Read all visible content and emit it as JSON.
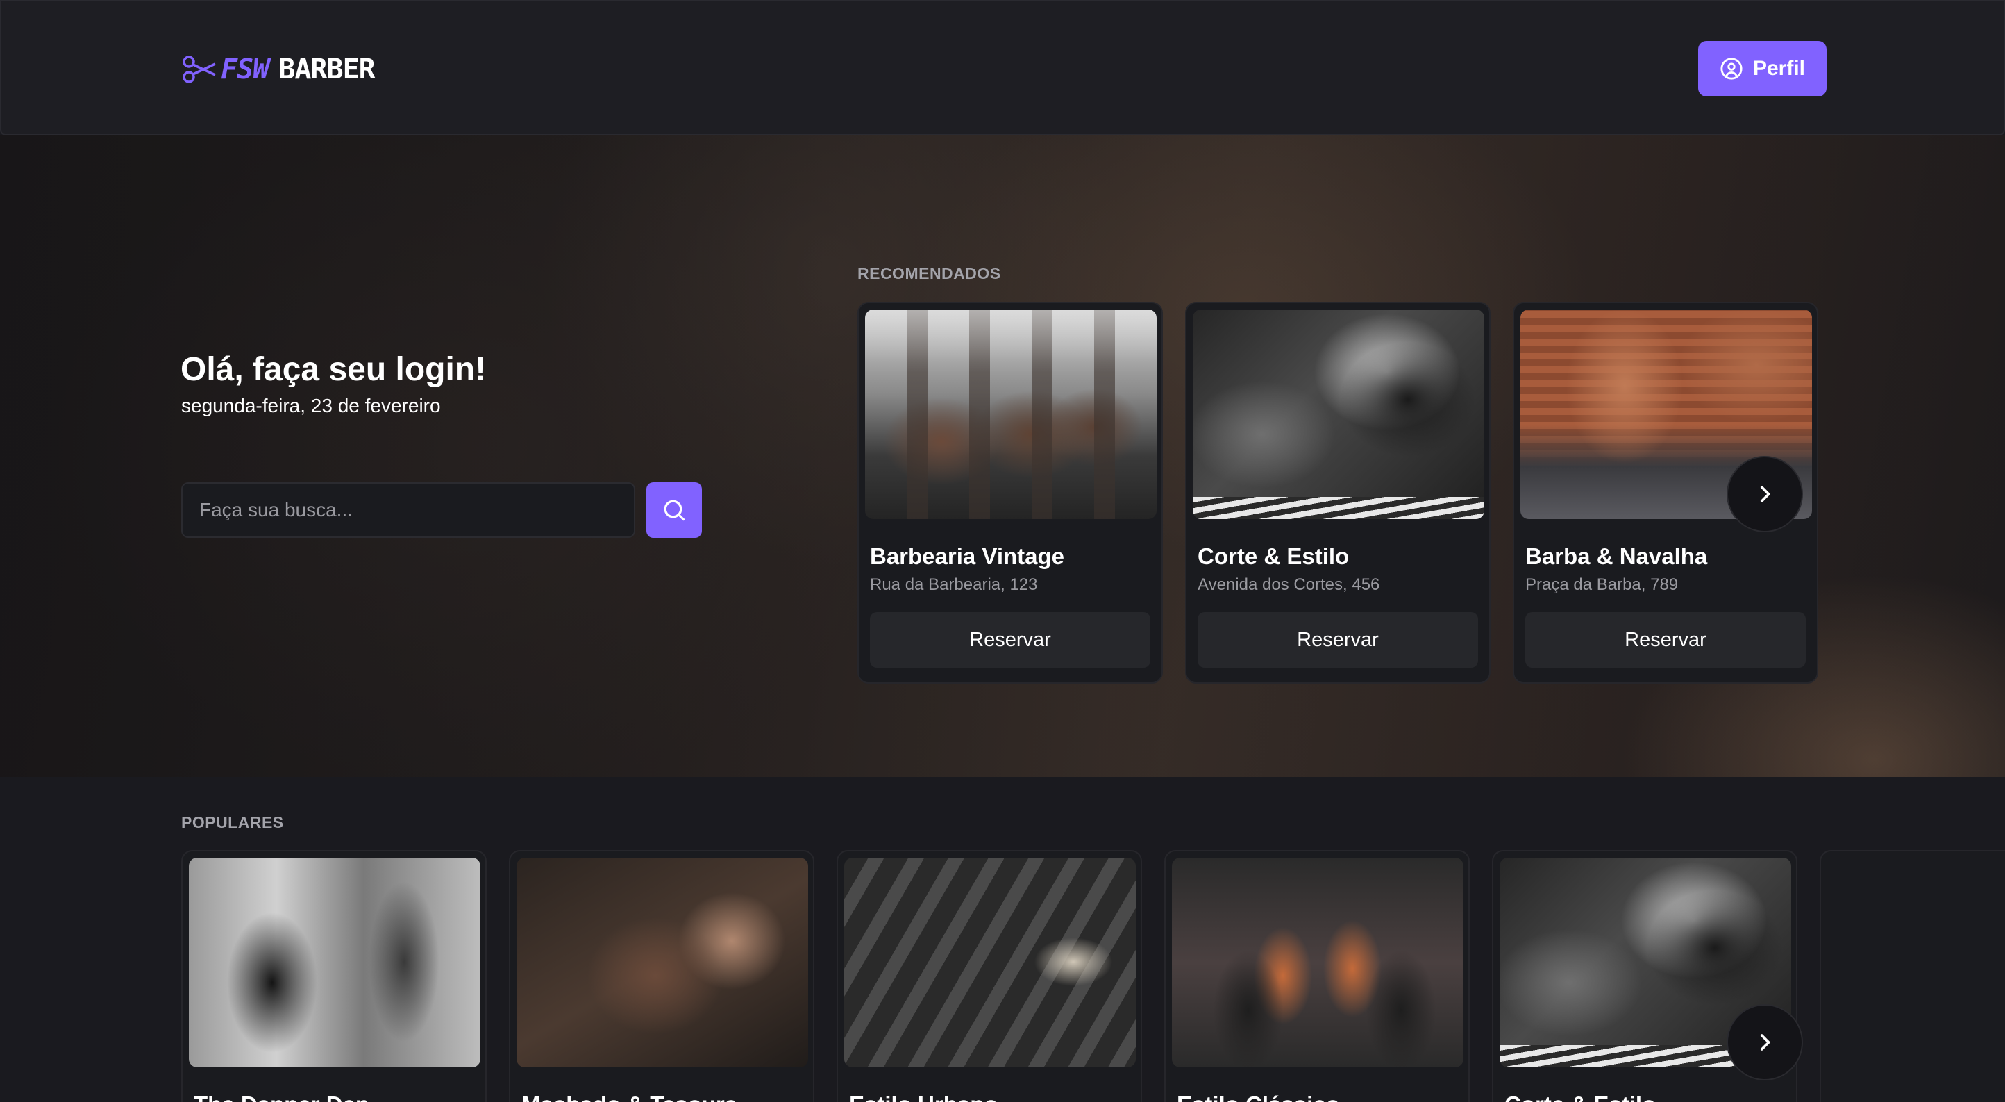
{
  "header": {
    "logo_fsw": "FSW",
    "logo_barber": "BARBER",
    "profile_label": "Perfil"
  },
  "hero": {
    "greeting": "Olá, faça seu login!",
    "date": "segunda-feira, 23 de fevereiro",
    "search_placeholder": "Faça sua busca..."
  },
  "recommended": {
    "title": "RECOMENDADOS",
    "items": [
      {
        "name": "Barbearia Vintage",
        "address": "Rua da Barbearia, 123",
        "button": "Reservar"
      },
      {
        "name": "Corte & Estilo",
        "address": "Avenida dos Cortes, 456",
        "button": "Reservar"
      },
      {
        "name": "Barba & Navalha",
        "address": "Praça da Barba, 789",
        "button": "Reservar"
      }
    ]
  },
  "popular": {
    "title": "POPULARES",
    "items": [
      {
        "name": "The Dapper Den"
      },
      {
        "name": "Machado & Tesoura"
      },
      {
        "name": "Estilo Urbano"
      },
      {
        "name": "Estilo Clássico"
      },
      {
        "name": "Corte & Estilo"
      }
    ]
  },
  "colors": {
    "accent": "#8162ff",
    "background": "#1a1a1f",
    "card": "#1a1b1f",
    "button_secondary": "#26272b"
  },
  "icons": {
    "logo": "scissors-icon",
    "profile": "user-circle-icon",
    "search": "search-icon",
    "next": "chevron-right-icon"
  }
}
